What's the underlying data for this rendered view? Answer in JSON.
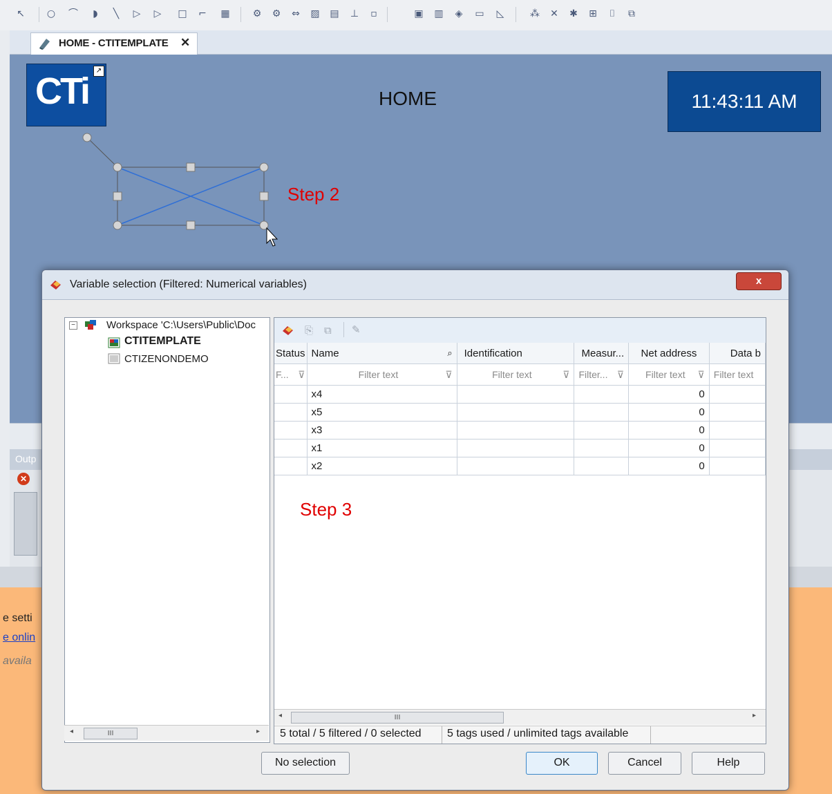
{
  "document_tab": {
    "label": "HOME - CTITEMPLATE",
    "close": "✕"
  },
  "screen": {
    "logo_text": "CTi",
    "title": "HOME",
    "clock": "11:43:11 AM",
    "step2": "Step 2",
    "step3": "Step 3"
  },
  "background_fragments": {
    "output_label": "Outp",
    "line1": "e setti",
    "line2": "e onlin",
    "line3": "availa"
  },
  "dialog": {
    "title": "Variable selection (Filtered: Numerical variables)",
    "close_label": "x",
    "tree": {
      "workspace": "Workspace 'C:\\Users\\Public\\Doc",
      "projects": [
        "CTITEMPLATE",
        "CTIZENONDEMO"
      ]
    },
    "grid": {
      "columns": [
        "Status",
        "Name",
        "Identification",
        "Measur...",
        "Net address",
        "Data b"
      ],
      "filters": [
        "F...",
        "Filter text",
        "Filter text",
        "Filter...",
        "Filter text",
        "Filter text"
      ],
      "rows": [
        {
          "name": "x4",
          "net_address": "0"
        },
        {
          "name": "x5",
          "net_address": "0"
        },
        {
          "name": "x3",
          "net_address": "0"
        },
        {
          "name": "x1",
          "net_address": "0"
        },
        {
          "name": "x2",
          "net_address": "0"
        }
      ],
      "status_left": "5 total / 5 filtered / 0 selected",
      "status_right": "5 tags used / unlimited tags available"
    },
    "buttons": {
      "no_selection": "No selection",
      "ok": "OK",
      "cancel": "Cancel",
      "help": "Help"
    }
  },
  "colors": {
    "canvas_bg": "#7994ba",
    "logo_bg": "#0d4ea0",
    "clock_bg": "#0c4a92",
    "step_text": "#e00000",
    "lower_panel": "#fbb879"
  }
}
